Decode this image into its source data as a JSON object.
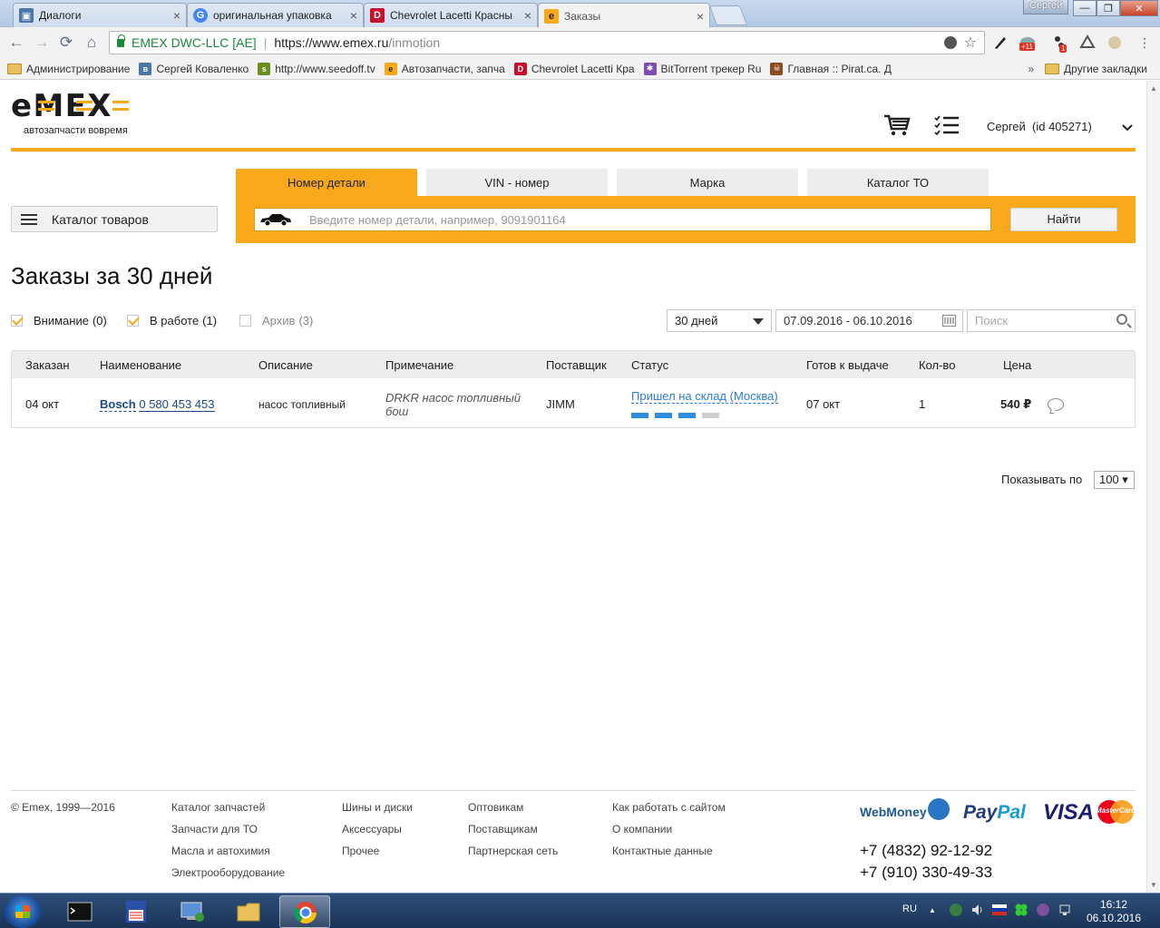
{
  "browser": {
    "tabs": [
      {
        "label": "Диалоги",
        "color": "#4a76a8",
        "glyph": "▣"
      },
      {
        "label": "оригинальная упаковка",
        "color": "#4285f4",
        "glyph": "G"
      },
      {
        "label": "Chevrolet Lacetti Красны",
        "color": "#c8102e",
        "glyph": "D"
      },
      {
        "label": "Заказы",
        "color": "#f7a81b",
        "glyph": "e"
      }
    ],
    "user_badge": "Сергей",
    "window_controls": {
      "minimize": "—",
      "restore": "❐",
      "close": "✕"
    },
    "nav": {
      "back": "←",
      "forward": "→",
      "reload": "⟳",
      "home": "⌂"
    },
    "omnibox": {
      "site_name": "EMEX DWC-LLC [AE]",
      "url_host": "https://www.emex.ru",
      "url_path": "/inmotion"
    },
    "extensions": {
      "badge_1": "+11",
      "badge_2": "1"
    },
    "bookmarks": [
      {
        "label": "Администрирование",
        "type": "folder"
      },
      {
        "label": "Сергей Коваленко",
        "type": "vk",
        "color": "#4a76a8",
        "glyph": "в"
      },
      {
        "label": "http://www.seedoff.tv",
        "type": "site",
        "color": "#6b8e23",
        "glyph": "s"
      },
      {
        "label": "Автозапчасти, запча",
        "type": "site",
        "color": "#f7a81b",
        "glyph": "e"
      },
      {
        "label": "Chevrolet Lacetti Кра",
        "type": "site",
        "color": "#c8102e",
        "glyph": "D"
      },
      {
        "label": "BitTorrent трекер Ru",
        "type": "site",
        "color": "#7a4fb0",
        "glyph": "✱"
      },
      {
        "label": "Главная :: Pirat.ca. Д",
        "type": "site",
        "color": "#8a4b1f",
        "glyph": "☠"
      }
    ],
    "bookmarks_more": "»",
    "other_bookmarks": "Другие закладки"
  },
  "header": {
    "logo_text": "e-M-E-X",
    "logo_tagline": "автозапчасти вовремя",
    "user": "Сергей  (id 405271)",
    "user_menu_chevron": "⌄"
  },
  "catalog_button": "Каталог товаров",
  "search": {
    "tabs": [
      "Номер детали",
      "VIN - номер",
      "Марка",
      "Каталог ТО"
    ],
    "active_tab": 0,
    "placeholder": "Введите номер детали, например, 9091901164",
    "button": "Найти"
  },
  "page_title": "Заказы за 30 дней",
  "filters": [
    {
      "label": "Внимание",
      "count": "(0)",
      "checked": true
    },
    {
      "label": "В работе",
      "count": "(1)",
      "checked": true
    },
    {
      "label": "Архив",
      "count": "(3)",
      "checked": false
    }
  ],
  "period": {
    "selected": "30 дней",
    "date_range": "07.09.2016 - 06.10.2016",
    "search_placeholder": "Поиск"
  },
  "table": {
    "headers": [
      "Заказан",
      "Наименование",
      "Описание",
      "Примечание",
      "Поставщик",
      "Статус",
      "Готов к выдаче",
      "Кол-во",
      "Цена"
    ],
    "rows": [
      {
        "ordered": "04 окт",
        "brand": "Bosch",
        "part_number": "0 580 453 453",
        "description": "насос топливный",
        "note_line1": "DRKR насос топливный",
        "note_line2": "бош",
        "supplier": "JIMM",
        "status": "Пришел на склад (Москва)",
        "progress_steps_done": 3,
        "progress_steps_total": 4,
        "ready": "07 окт",
        "qty": "1",
        "price": "540 ₽"
      }
    ]
  },
  "pager": {
    "label": "Показывать по",
    "value": "100 ▾"
  },
  "footer": {
    "copyright": "© Emex, 1999—2016",
    "col1": [
      "Каталог запчастей",
      "Запчасти для ТО",
      "Масла и автохимия",
      "Электрооборудование"
    ],
    "col2": [
      "Шины и диски",
      "Аксессуары",
      "Прочее"
    ],
    "col3": [
      "Оптовикам",
      "Поставщикам",
      "Партнерская сеть"
    ],
    "col4": [
      "Как работать с сайтом",
      "О компании",
      "Контактные данные"
    ],
    "payments": {
      "webmoney": "WebMoney",
      "paypal_a": "Pay",
      "paypal_b": "Pal",
      "visa": "VISA",
      "mastercard": "MasterCard"
    },
    "phones": [
      "+7 (4832) 92-12-92",
      "+7 (910) 330-49-33"
    ]
  },
  "taskbar": {
    "lang": "RU",
    "tray_arrow": "▲",
    "time": "16:12",
    "date": "06.10.2016"
  },
  "colors": {
    "accent": "#f7a81b",
    "link": "#1b4a8c",
    "status_link": "#2d7dd2",
    "progress_done": "#2d8ee0",
    "progress_todo": "#cfcfcf"
  }
}
